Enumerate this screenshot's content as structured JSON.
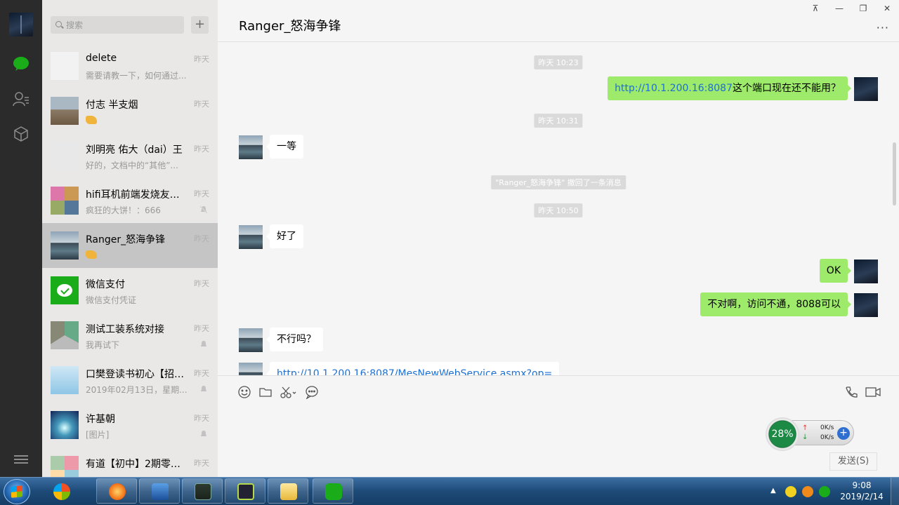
{
  "search": {
    "placeholder": "搜索"
  },
  "conversations": [
    {
      "name": "delete",
      "snippet": "需要请教一下，如何通过...",
      "time": "昨天"
    },
    {
      "name": "付志 半支烟",
      "snippet": "",
      "time": "昨天"
    },
    {
      "name": "刘明亮 佑大（dai）王",
      "snippet": "好的，文档中的“其他”...",
      "time": "昨天"
    },
    {
      "name": "hifi耳机前端发烧友交...",
      "snippet": "疯狂的大饼！：666",
      "time": "昨天"
    },
    {
      "name": "Ranger_怒海争锋",
      "snippet": "",
      "time": "昨天"
    },
    {
      "name": "微信支付",
      "snippet": "微信支付凭证",
      "time": "昨天"
    },
    {
      "name": "测试工装系统对接",
      "snippet": "我再试下",
      "time": "昨天"
    },
    {
      "name": "口樊登读书初心【招 ...",
      "snippet": "2019年02月13日，星期...",
      "time": "昨天"
    },
    {
      "name": "许基朝",
      "snippet": "[图片]",
      "time": "昨天"
    },
    {
      "name": "有道【初中】2期零基...",
      "snippet": "",
      "time": "昨天"
    }
  ],
  "chat": {
    "title": "Ranger_怒海争锋",
    "more": "···",
    "win": {
      "pin": "⊼",
      "min": "—",
      "max": "❐",
      "close": "✕"
    },
    "timestamps": [
      "昨天 10:23",
      "昨天 10:31",
      "昨天 10:50"
    ],
    "recall_notice": "\"Ranger_怒海争锋\" 撤回了一条消息",
    "msg_link1": "http://10.1.200.16:8087",
    "msg_text1": "这个端口现在还不能用？",
    "msg_2": "一等",
    "msg_3": "好了",
    "msg_4": "OK",
    "msg_5": "不对啊，访问不通，8088可以",
    "msg_6": "不行吗？",
    "msg_7": "http://10.1.200.16:8087/MesNewWebService.asmx?op=",
    "send_label": "发送(S)"
  },
  "netmon": {
    "percent": "28%",
    "up": "0K/s",
    "down": "0K/s"
  },
  "taskbar": {
    "time": "9:08",
    "date": "2019/2/14"
  },
  "colors": {
    "accent": "#1aad19",
    "bubble_out": "#9eea6a",
    "rail": "#2b2b2b"
  }
}
